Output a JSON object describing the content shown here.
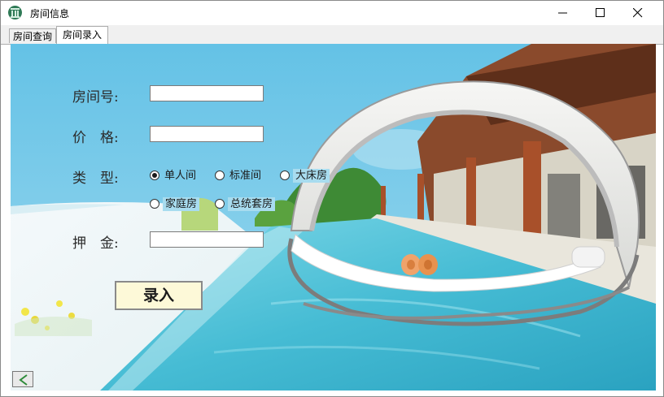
{
  "window": {
    "title": "房间信息"
  },
  "tabs": [
    {
      "label": "房间查询",
      "active": false
    },
    {
      "label": "房间录入",
      "active": true
    }
  ],
  "form": {
    "room_no_label": "房间号:",
    "room_no_value": "",
    "price_label": "价　格:",
    "price_value": "",
    "type_label": "类　型:",
    "type_options": [
      {
        "label": "单人间",
        "checked": true
      },
      {
        "label": "标准间",
        "checked": false
      },
      {
        "label": "大床房",
        "checked": false
      },
      {
        "label": "家庭房",
        "checked": false
      },
      {
        "label": "总统套房",
        "checked": false
      }
    ],
    "deposit_label": "押　金:",
    "deposit_value": "",
    "submit_label": "录入"
  },
  "icons": {
    "app": "hotel-building-icon",
    "minimize": "minimize-icon",
    "maximize": "maximize-icon",
    "close": "close-icon",
    "back": "chevron-left-icon"
  },
  "colors": {
    "sky": "#6cc6e8",
    "pool": "#4fc3d8",
    "button_bg": "#fdf9d8",
    "back_arrow": "#2e8b3a"
  }
}
